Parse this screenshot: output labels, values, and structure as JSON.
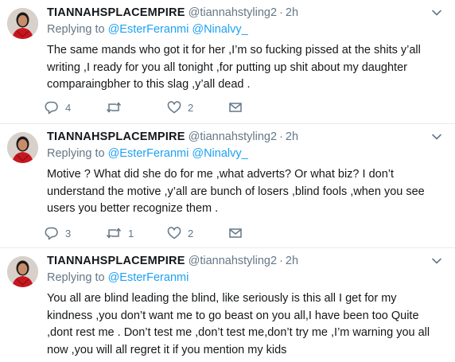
{
  "tweets": [
    {
      "name": "TIANNAHSPLACEMPIRE",
      "handle": "@tiannahstyling2",
      "dot": "·",
      "time": "2h",
      "replying_prefix": "Replying to ",
      "mentions": [
        "@EsterFeranmi",
        "@Ninalvy_"
      ],
      "text": "The same mands who got it for her ,I’m so fucking pissed at the shits y’all writing ,I ready for you all tonight ,for putting up shit about my daughter comparaingbher to this slag ,y’all dead .",
      "reply_count": "4",
      "retweet_count": "",
      "like_count": "2"
    },
    {
      "name": "TIANNAHSPLACEMPIRE",
      "handle": "@tiannahstyling2",
      "dot": "·",
      "time": "2h",
      "replying_prefix": "Replying to ",
      "mentions": [
        "@EsterFeranmi",
        "@Ninalvy_"
      ],
      "text": "Motive ? What did she do for me ,what adverts? Or what biz? I don’t understand the motive ,y’all are bunch of losers ,blind fools ,when you see users you better recognize them .",
      "reply_count": "3",
      "retweet_count": "1",
      "like_count": "2"
    },
    {
      "name": "TIANNAHSPLACEMPIRE",
      "handle": "@tiannahstyling2",
      "dot": "·",
      "time": "2h",
      "replying_prefix": "Replying to ",
      "mentions": [
        "@EsterFeranmi"
      ],
      "text": "You all are blind leading the blind, like seriously is this all I get for my kindness ,you don’t want me to go beast on you all,I have been too Quite ,dont rest me . Don’t test me ,don’t test me,don’t try me ,I’m warning you all now ,you will all regret it if you mention my kids"
    }
  ],
  "icons": {
    "reply": "reply-icon",
    "retweet": "retweet-icon",
    "like": "like-icon",
    "dm": "direct-message-icon",
    "caret": "chevron-down-icon"
  },
  "colors": {
    "link": "#1da1f2",
    "secondary": "#657786",
    "text": "#14171a",
    "border": "#e6ecf0"
  }
}
